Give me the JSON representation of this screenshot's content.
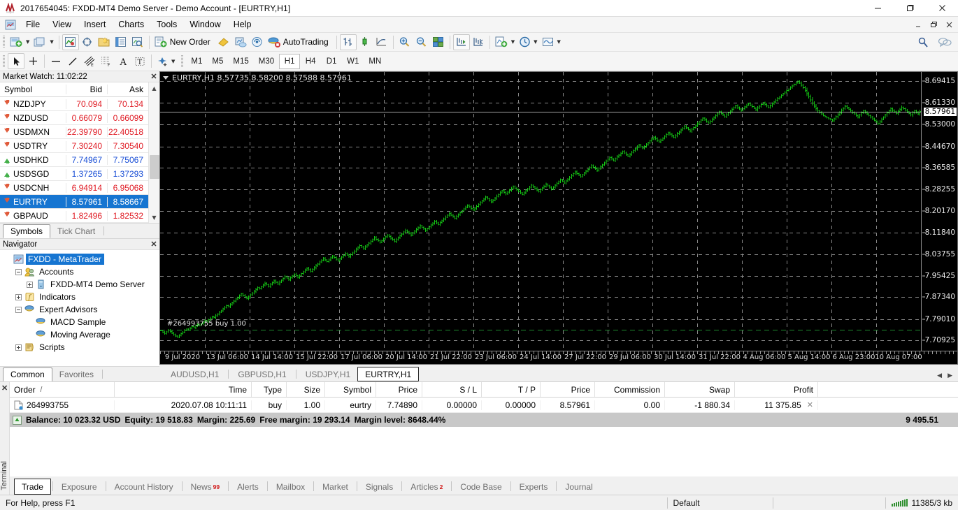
{
  "window": {
    "title": "2017654045: FXDD-MT4 Demo Server - Demo Account - [EURTRY,H1]",
    "minimize": "—",
    "maximize": "❐",
    "close": "✕"
  },
  "mdi_buttons": {
    "minimize": "–",
    "restore": "❐",
    "close": "✕"
  },
  "menu": {
    "items": [
      "File",
      "View",
      "Insert",
      "Charts",
      "Tools",
      "Window",
      "Help"
    ]
  },
  "toolbar_main": {
    "new_order_label": "New Order",
    "autotrading_label": "AutoTrading",
    "icons": [
      "new-chart-icon",
      "profiles-icon",
      "market-watch-icon",
      "data-window-icon",
      "navigator-icon",
      "terminal-icon",
      "strategy-tester-icon",
      "new-order-icon",
      "metaeditor-icon",
      "metaquotes-id-icon",
      "signals-icon",
      "autotrading-icon",
      "bar-chart-icon",
      "candlestick-chart-icon",
      "line-chart-icon",
      "zoom-in-icon",
      "zoom-out-icon",
      "tile-windows-icon",
      "auto-scroll-icon",
      "chart-shift-icon",
      "indicators-icon",
      "periods-icon",
      "templates-icon"
    ],
    "search_icon": "search-icon",
    "chat_icon": "chat-icon"
  },
  "toolbar_line": {
    "tools": [
      "cursor-icon",
      "crosshair-icon",
      "trendline-icon",
      "horizontal-line-icon",
      "equidistant-channel-icon",
      "fibonacci-icon",
      "text-label-icon",
      "text-icon",
      "arrows-icon"
    ],
    "timeframes": [
      "M1",
      "M5",
      "M15",
      "M30",
      "H1",
      "H4",
      "D1",
      "W1",
      "MN"
    ],
    "active_timeframe": "H1"
  },
  "market_watch": {
    "title": "Market Watch: 11:02:22",
    "columns": [
      "Symbol",
      "Bid",
      "Ask"
    ],
    "rows": [
      {
        "symbol": "NZDJPY",
        "bid": "70.094",
        "ask": "70.134",
        "dir": "down",
        "color": "red",
        "selected": false
      },
      {
        "symbol": "NZDUSD",
        "bid": "0.66079",
        "ask": "0.66099",
        "dir": "down",
        "color": "red",
        "selected": false
      },
      {
        "symbol": "USDMXN",
        "bid": "22.39790",
        "ask": "22.40518",
        "dir": "down",
        "color": "red",
        "selected": false
      },
      {
        "symbol": "USDTRY",
        "bid": "7.30240",
        "ask": "7.30540",
        "dir": "down",
        "color": "red",
        "selected": false
      },
      {
        "symbol": "USDHKD",
        "bid": "7.74967",
        "ask": "7.75067",
        "dir": "up",
        "color": "blue",
        "selected": false
      },
      {
        "symbol": "USDSGD",
        "bid": "1.37265",
        "ask": "1.37293",
        "dir": "up",
        "color": "blue",
        "selected": false
      },
      {
        "symbol": "USDCNH",
        "bid": "6.94914",
        "ask": "6.95068",
        "dir": "down",
        "color": "red",
        "selected": false
      },
      {
        "symbol": "EURTRY",
        "bid": "8.57961",
        "ask": "8.58667",
        "dir": "down",
        "color": "blue",
        "selected": true
      },
      {
        "symbol": "GBPAUD",
        "bid": "1.82496",
        "ask": "1.82532",
        "dir": "down",
        "color": "red",
        "selected": false
      }
    ],
    "tabs": [
      {
        "label": "Symbols",
        "active": true
      },
      {
        "label": "Tick Chart",
        "active": false
      }
    ]
  },
  "navigator": {
    "title": "Navigator",
    "tree": [
      {
        "label": "FXDD - MetaTrader",
        "depth": 0,
        "expander": "",
        "icon": "metatrader-icon",
        "selected": true
      },
      {
        "label": "Accounts",
        "depth": 1,
        "expander": "minus",
        "icon": "accounts-icon",
        "selected": false
      },
      {
        "label": "FXDD-MT4 Demo Server",
        "depth": 2,
        "expander": "plus",
        "icon": "server-icon",
        "selected": false
      },
      {
        "label": "Indicators",
        "depth": 1,
        "expander": "plus",
        "icon": "indicators-fx-icon",
        "selected": false
      },
      {
        "label": "Expert Advisors",
        "depth": 1,
        "expander": "minus",
        "icon": "expert-advisor-icon",
        "selected": false
      },
      {
        "label": "MACD Sample",
        "depth": 2,
        "expander": "",
        "icon": "expert-advisor-icon",
        "selected": false
      },
      {
        "label": "Moving Average",
        "depth": 2,
        "expander": "",
        "icon": "expert-advisor-icon",
        "selected": false
      },
      {
        "label": "Scripts",
        "depth": 1,
        "expander": "plus",
        "icon": "scripts-icon",
        "selected": false
      }
    ],
    "tabs": [
      {
        "label": "Common",
        "active": true
      },
      {
        "label": "Favorites",
        "active": false
      }
    ]
  },
  "chart": {
    "header": "EURTRY,H1  8.57735 8.58200 8.57588 8.57961",
    "symbol": "EURTRY",
    "period": "H1",
    "ohlc": {
      "open": "8.57735",
      "high": "8.58200",
      "low": "8.57588",
      "close": "8.57961"
    },
    "current_price": "8.57961",
    "order_line_label": "#264993755 buy 1.00",
    "tabs": [
      {
        "label": "AUDUSD,H1",
        "active": false
      },
      {
        "label": "GBPUSD,H1",
        "active": false
      },
      {
        "label": "USDJPY,H1",
        "active": false
      },
      {
        "label": "EURTRY,H1",
        "active": true
      }
    ]
  },
  "chart_data": {
    "type": "line",
    "title": "EURTRY,H1",
    "xlabel": "",
    "ylabel": "",
    "grid": true,
    "legend": "none",
    "series_color": "#14c514",
    "ylim": [
      7.67,
      8.73
    ],
    "y_ticks": [
      "8.69415",
      "8.61330",
      "8.53000",
      "8.44670",
      "8.36585",
      "8.28255",
      "8.20170",
      "8.11840",
      "8.03755",
      "7.95425",
      "7.87340",
      "7.79010",
      "7.70925"
    ],
    "x_ticks": [
      "9 Jul 2020",
      "13 Jul 06:00",
      "14 Jul 14:00",
      "15 Jul 22:00",
      "17 Jul 06:00",
      "20 Jul 14:00",
      "21 Jul 22:00",
      "23 Jul 06:00",
      "24 Jul 14:00",
      "27 Jul 22:00",
      "29 Jul 06:00",
      "30 Jul 14:00",
      "31 Jul 22:00",
      "4 Aug 06:00",
      "5 Aug 14:00",
      "6 Aug 23:00",
      "10 Aug 07:00"
    ],
    "order_level": 7.7489,
    "current_level": 8.57961,
    "close_values": [
      7.746,
      7.74,
      7.735,
      7.742,
      7.748,
      7.743,
      7.737,
      7.731,
      7.726,
      7.722,
      7.728,
      7.735,
      7.741,
      7.747,
      7.752,
      7.749,
      7.755,
      7.762,
      7.758,
      7.764,
      7.77,
      7.766,
      7.772,
      7.779,
      7.785,
      7.781,
      7.788,
      7.794,
      7.8,
      7.796,
      7.803,
      7.809,
      7.816,
      7.822,
      7.829,
      7.835,
      7.842,
      7.838,
      7.845,
      7.852,
      7.859,
      7.866,
      7.872,
      7.879,
      7.886,
      7.88,
      7.874,
      7.868,
      7.875,
      7.882,
      7.889,
      7.896,
      7.903,
      7.91,
      7.906,
      7.913,
      7.92,
      7.927,
      7.921,
      7.915,
      7.922,
      7.929,
      7.936,
      7.93,
      7.924,
      7.931,
      7.938,
      7.945,
      7.952,
      7.946,
      7.94,
      7.947,
      7.954,
      7.961,
      7.955,
      7.949,
      7.956,
      7.963,
      7.97,
      7.977,
      7.984,
      7.978,
      7.972,
      7.979,
      7.986,
      7.993,
      8.0,
      8.007,
      8.014,
      8.021,
      8.015,
      8.009,
      8.016,
      8.023,
      8.03,
      8.024,
      8.018,
      8.012,
      8.019,
      8.026,
      8.033,
      8.04,
      8.034,
      8.028,
      8.035,
      8.042,
      8.049,
      8.056,
      8.063,
      8.07,
      8.064,
      8.058,
      8.065,
      8.072,
      8.079,
      8.086,
      8.093,
      8.1,
      8.094,
      8.088,
      8.082,
      8.089,
      8.096,
      8.103,
      8.11,
      8.104,
      8.098,
      8.092,
      8.086,
      8.093,
      8.1,
      8.107,
      8.114,
      8.121,
      8.128,
      8.122,
      8.116,
      8.11,
      8.117,
      8.124,
      8.131,
      8.138,
      8.145,
      8.139,
      8.133,
      8.127,
      8.134,
      8.141,
      8.148,
      8.155,
      8.162,
      8.156,
      8.15,
      8.157,
      8.164,
      8.171,
      8.178,
      8.185,
      8.192,
      8.186,
      8.18,
      8.174,
      8.181,
      8.188,
      8.195,
      8.202,
      8.209,
      8.216,
      8.223,
      8.217,
      8.211,
      8.205,
      8.212,
      8.219,
      8.226,
      8.233,
      8.24,
      8.247,
      8.254,
      8.248,
      8.242,
      8.236,
      8.243,
      8.25,
      8.257,
      8.264,
      8.271,
      8.278,
      8.272,
      8.266,
      8.273,
      8.28,
      8.287,
      8.294,
      8.288,
      8.282,
      8.276,
      8.27,
      8.264,
      8.271,
      8.278,
      8.285,
      8.292,
      8.299,
      8.293,
      8.287,
      8.281,
      8.275,
      8.282,
      8.289,
      8.296,
      8.303,
      8.297,
      8.291,
      8.285,
      8.292,
      8.299,
      8.306,
      8.313,
      8.32,
      8.314,
      8.308,
      8.315,
      8.322,
      8.329,
      8.336,
      8.343,
      8.35,
      8.344,
      8.338,
      8.332,
      8.339,
      8.346,
      8.353,
      8.36,
      8.367,
      8.374,
      8.368,
      8.362,
      8.356,
      8.363,
      8.37,
      8.377,
      8.384,
      8.391,
      8.398,
      8.405,
      8.399,
      8.393,
      8.4,
      8.407,
      8.414,
      8.421,
      8.428,
      8.422,
      8.416,
      8.41,
      8.417,
      8.424,
      8.431,
      8.438,
      8.445,
      8.452,
      8.446,
      8.44,
      8.447,
      8.454,
      8.461,
      8.468,
      8.475,
      8.482,
      8.476,
      8.47,
      8.464,
      8.471,
      8.478,
      8.485,
      8.492,
      8.499,
      8.493,
      8.487,
      8.481,
      8.488,
      8.495,
      8.502,
      8.509,
      8.516,
      8.523,
      8.517,
      8.511,
      8.505,
      8.512,
      8.519,
      8.526,
      8.533,
      8.54,
      8.547,
      8.554,
      8.548,
      8.542,
      8.536,
      8.543,
      8.55,
      8.557,
      8.564,
      8.571,
      8.578,
      8.572,
      8.566,
      8.56,
      8.567,
      8.574,
      8.581,
      8.588,
      8.595,
      8.601,
      8.595,
      8.589,
      8.583,
      8.59,
      8.597,
      8.604,
      8.61,
      8.604,
      8.598,
      8.592,
      8.586,
      8.593,
      8.6,
      8.607,
      8.613,
      8.607,
      8.601,
      8.595,
      8.602,
      8.609,
      8.616,
      8.623,
      8.629,
      8.635,
      8.641,
      8.647,
      8.653,
      8.659,
      8.665,
      8.671,
      8.677,
      8.683,
      8.689,
      8.694,
      8.688,
      8.68,
      8.67,
      8.66,
      8.648,
      8.636,
      8.624,
      8.612,
      8.6,
      8.59,
      8.582,
      8.576,
      8.57,
      8.564,
      8.56,
      8.556,
      8.552,
      8.548,
      8.544,
      8.552,
      8.56,
      8.568,
      8.576,
      8.584,
      8.592,
      8.6,
      8.594,
      8.588,
      8.582,
      8.576,
      8.57,
      8.564,
      8.558,
      8.566,
      8.574,
      8.582,
      8.576,
      8.57,
      8.564,
      8.558,
      8.552,
      8.546,
      8.54,
      8.534,
      8.542,
      8.55,
      8.558,
      8.566,
      8.574,
      8.582,
      8.59,
      8.584,
      8.578,
      8.572,
      8.58,
      8.588,
      8.596,
      8.59,
      8.584,
      8.578,
      8.572,
      8.566,
      8.574,
      8.582,
      8.576,
      8.57,
      8.58
    ]
  },
  "terminal": {
    "side_label": "Terminal",
    "columns": [
      "Order",
      "Time",
      "Type",
      "Size",
      "Symbol",
      "Price",
      "S / L",
      "T / P",
      "Price",
      "Commission",
      "Swap",
      "Profit"
    ],
    "sort_indicator": "/",
    "rows": [
      {
        "order": "264993755",
        "time": "2020.07.08 10:11:11",
        "type": "buy",
        "size": "1.00",
        "symbol": "eurtry",
        "open_price": "7.74890",
        "sl": "0.00000",
        "tp": "0.00000",
        "price": "8.57961",
        "commission": "0.00",
        "swap": "-1 880.34",
        "profit": "11 375.85"
      }
    ],
    "summary": {
      "balance": "Balance: 10 023.32 USD",
      "equity": "Equity: 19 518.83",
      "margin": "Margin: 225.69",
      "free_margin": "Free margin: 19 293.14",
      "margin_level": "Margin level: 8648.44%",
      "total_profit": "9 495.51"
    },
    "tabs": [
      {
        "label": "Trade",
        "active": true,
        "badge": ""
      },
      {
        "label": "Exposure",
        "active": false,
        "badge": ""
      },
      {
        "label": "Account History",
        "active": false,
        "badge": ""
      },
      {
        "label": "News",
        "active": false,
        "badge": "99"
      },
      {
        "label": "Alerts",
        "active": false,
        "badge": ""
      },
      {
        "label": "Mailbox",
        "active": false,
        "badge": ""
      },
      {
        "label": "Market",
        "active": false,
        "badge": ""
      },
      {
        "label": "Signals",
        "active": false,
        "badge": ""
      },
      {
        "label": "Articles",
        "active": false,
        "badge": "2"
      },
      {
        "label": "Code Base",
        "active": false,
        "badge": ""
      },
      {
        "label": "Experts",
        "active": false,
        "badge": ""
      },
      {
        "label": "Journal",
        "active": false,
        "badge": ""
      }
    ]
  },
  "statusbar": {
    "help": "For Help, press F1",
    "profile": "Default",
    "connection": "11385/3 kb"
  }
}
